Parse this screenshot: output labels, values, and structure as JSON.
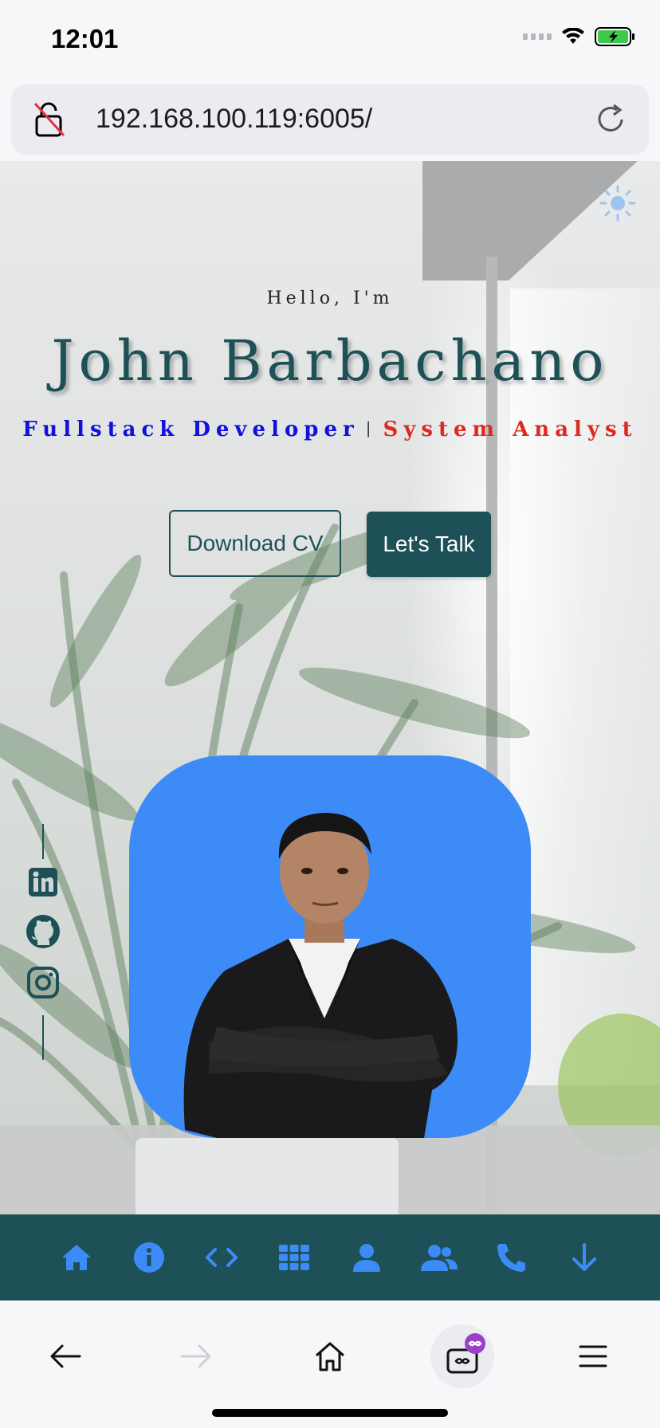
{
  "status_bar": {
    "time": "12:01"
  },
  "browser": {
    "url": "192.168.100.119:6005/"
  },
  "hero": {
    "greeting": "Hello, I'm",
    "name": "John Barbachano",
    "role_primary": "Fullstack Developer",
    "role_separator": "|",
    "role_secondary": "System Analyst",
    "download_button": "Download CV",
    "talk_button": "Let's Talk"
  },
  "colors": {
    "brand": "#1d5157",
    "role_primary": "#1010e0",
    "role_secondary": "#dd2a22",
    "photo_bg": "#3d8bf7",
    "nav_icon": "#3d8bf7"
  },
  "social_icons": [
    "linkedin-icon",
    "github-icon",
    "instagram-icon"
  ],
  "bottom_nav": [
    "home-icon",
    "info-icon",
    "code-icon",
    "grid-icon",
    "user-icon",
    "users-icon",
    "phone-icon",
    "arrow-down-icon"
  ],
  "browser_toolbar": [
    "back-icon",
    "forward-icon",
    "home-icon",
    "tabs-icon",
    "menu-icon"
  ]
}
